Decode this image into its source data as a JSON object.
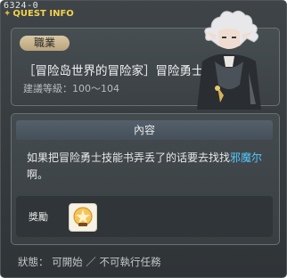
{
  "window": {
    "quest_id": "6324-0",
    "title": "QUEST INFO"
  },
  "quest": {
    "job_badge": "職業",
    "name": "［冒险岛世界的冒险家］冒险勇士技能",
    "level": "建議等級：100～104"
  },
  "content": {
    "header": "內容",
    "text_before": "如果把冒险勇士技能书弄丢了的话要去找找",
    "npc": "邪魔尔",
    "text_after": "啊。"
  },
  "reward": {
    "label": "獎勵"
  },
  "status": {
    "text": "狀態： 可開始 ／ 不可執行任務"
  },
  "colors": {
    "title": "#f3d24b",
    "npc": "#53c8ff",
    "panel": "#3b4144"
  },
  "icons": {
    "portrait": "npc-portrait",
    "reward": "skill-book-icon"
  }
}
